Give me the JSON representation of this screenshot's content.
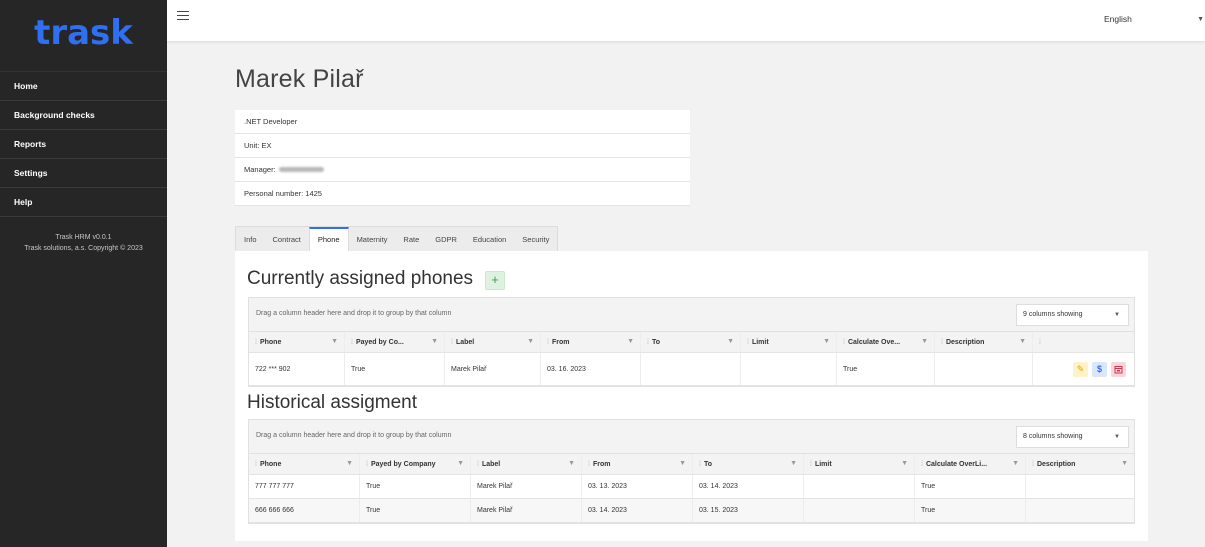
{
  "brand": {
    "logo_text": "trask",
    "logo_color": "#2f6ff0"
  },
  "sidebar": {
    "items": [
      {
        "label": "Home"
      },
      {
        "label": "Background checks"
      },
      {
        "label": "Reports"
      },
      {
        "label": "Settings"
      },
      {
        "label": "Help"
      }
    ],
    "footer_version": "Trask HRM v0.0.1",
    "footer_copyright": "Trask solutions, a.s. Copyright © 2023"
  },
  "topbar": {
    "menu_icon": "hamburger-icon",
    "language": "English"
  },
  "profile": {
    "name": "Marek Pilař",
    "position": ".NET Developer",
    "unit": "Unit: EX",
    "manager_label": "Manager:",
    "personal_number": "Personal number: 1425"
  },
  "tabs": [
    {
      "label": "Info"
    },
    {
      "label": "Contract"
    },
    {
      "label": "Phone",
      "active": true
    },
    {
      "label": "Maternity"
    },
    {
      "label": "Rate"
    },
    {
      "label": "GDPR"
    },
    {
      "label": "Education"
    },
    {
      "label": "Security"
    }
  ],
  "current": {
    "title": "Currently assigned phones",
    "add_label": "+",
    "group_hint": "Drag a column header here and drop it to group by that column",
    "columns_showing": "9 columns showing",
    "columns": [
      "Phone",
      "Payed by Co...",
      "Label",
      "From",
      "To",
      "Limit",
      "Calculate Ove...",
      "Description",
      ""
    ],
    "rows": [
      [
        "722 *** 902",
        "True",
        "Marek Pilař",
        "03. 16. 2023",
        "",
        "",
        "True",
        "",
        ""
      ]
    ],
    "row_actions": [
      "edit-icon",
      "dollar-icon",
      "calendar-icon"
    ],
    "action_colors": {
      "edit": "#e0a800",
      "money": "#2f6ff0",
      "calendar": "#d0374d"
    }
  },
  "history": {
    "title": "Historical assigment",
    "group_hint": "Drag a column header here and drop it to group by that column",
    "columns_showing": "8 columns showing",
    "columns": [
      "Phone",
      "Payed by Company",
      "Label",
      "From",
      "To",
      "Limit",
      "Calculate OverLi...",
      "Description"
    ],
    "rows": [
      [
        "777 777 777",
        "True",
        "Marek Pilař",
        "03. 13. 2023",
        "03. 14. 2023",
        "",
        "True",
        ""
      ],
      [
        "666 666 666",
        "True",
        "Marek Pilař",
        "03. 14. 2023",
        "03. 15. 2023",
        "",
        "True",
        ""
      ]
    ]
  }
}
